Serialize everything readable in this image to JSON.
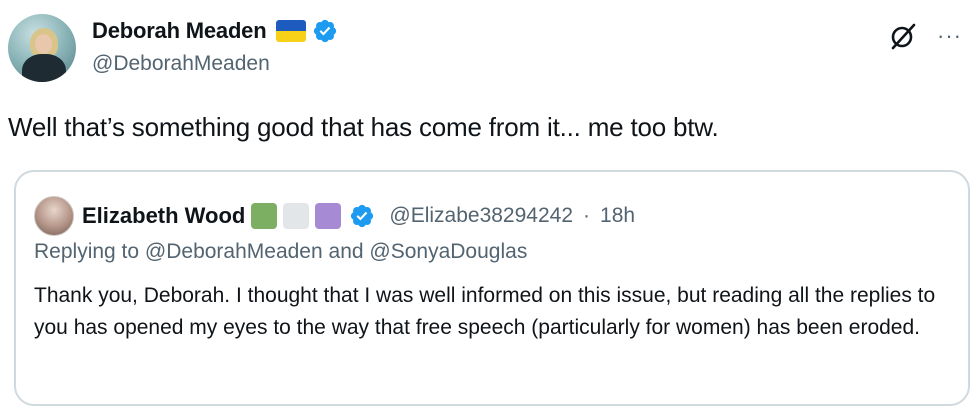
{
  "author": {
    "display_name": "Deborah Meaden",
    "handle": "@DeborahMeaden",
    "flag_colors": [
      "#1d5bbf",
      "#f7d117"
    ],
    "verified_color": "#1d9bf0"
  },
  "tweet": {
    "text": "Well that’s something good that has come from it... me too btw."
  },
  "quoted": {
    "display_name": "Elizabeth Wood",
    "badge_colors": [
      "#7daf63",
      "#e3e6e8",
      "#a78ad4"
    ],
    "handle": "@Elizabe38294242",
    "separator": "·",
    "time": "18h",
    "replying_prefix": "Replying to",
    "replying_to_1": "@DeborahMeaden",
    "replying_and": "and",
    "replying_to_2": "@SonyaDouglas",
    "body": "Thank you, Deborah. I thought that I was well informed on this issue, but reading all the replies to you has opened my eyes to the way that free speech (particularly for women) has been eroded."
  },
  "icons": {
    "grok": "grok-icon",
    "more": "more-icon",
    "verified": "verified-badge-icon"
  }
}
